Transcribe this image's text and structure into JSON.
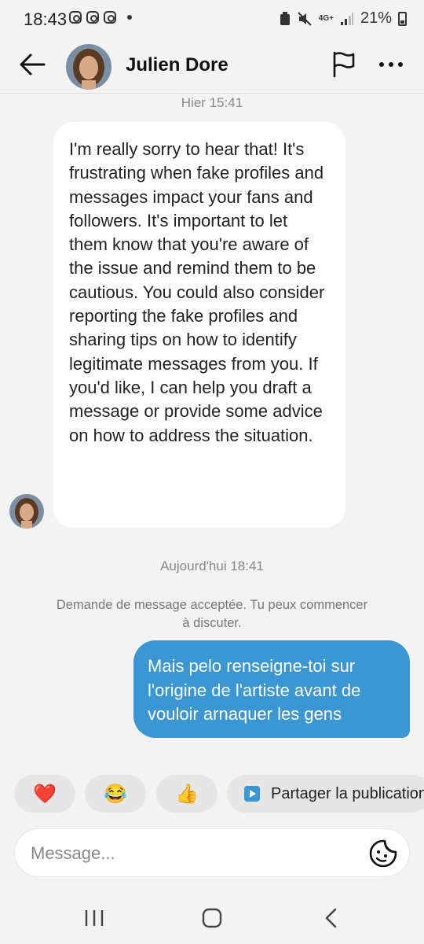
{
  "status_bar": {
    "time": "18:43",
    "network": "4G+",
    "battery": "21%"
  },
  "header": {
    "contact_name": "Julien Dore",
    "icons": [
      "back-arrow-icon",
      "avatar",
      "flag-icon",
      "more-icon"
    ]
  },
  "thread": {
    "timestamp_1": "Hier 15:41",
    "incoming_message": "I'm really sorry to hear that! It's frustrating when fake profiles and messages impact your fans and followers. It's important to let them know that you're aware of the issue and remind them to be cautious. You could also consider reporting the fake profiles and sharing tips on how to identify legitimate messages from you. If you'd like, I can help you draft a message or provide some advice on how to address the situation.",
    "timestamp_2": "Aujourd'hui 18:41",
    "system_notice": "Demande de message acceptée. Tu peux commencer à discuter.",
    "outgoing_message": "Mais pelo renseigne-toi sur l'origine de l'artiste avant de vouloir arnaquer les gens"
  },
  "quick_replies": [
    {
      "emoji": "❤️"
    },
    {
      "emoji": "😂"
    },
    {
      "emoji": "👍"
    },
    {
      "label": "Partager la publication",
      "icon": "play-icon"
    }
  ],
  "composer": {
    "placeholder": "Message...",
    "value": ""
  },
  "colors": {
    "accent_blue": "#3b97d4",
    "background": "#f3f3f3",
    "bubble_in": "#ffffff"
  }
}
